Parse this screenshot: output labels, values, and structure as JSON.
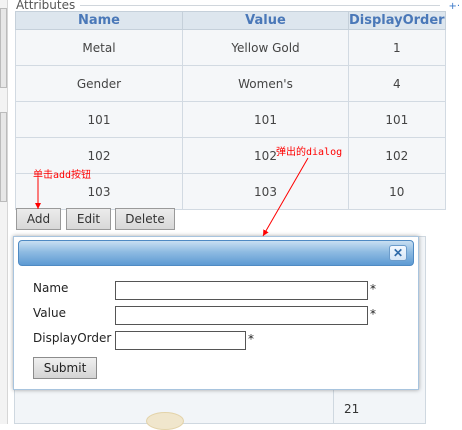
{
  "section": {
    "title": "Attributes"
  },
  "table": {
    "columns": [
      "Name",
      "Value",
      "DisplayOrder"
    ],
    "rows": [
      [
        "Metal",
        "Yellow Gold",
        "1"
      ],
      [
        "Gender",
        "Women's",
        "4"
      ],
      [
        "101",
        "101",
        "101"
      ],
      [
        "102",
        "102",
        "102"
      ],
      [
        "103",
        "103",
        "10"
      ]
    ]
  },
  "toolbar": {
    "add_label": "Add",
    "edit_label": "Edit",
    "delete_label": "Delete"
  },
  "annotations": {
    "click_add": "单击add按钮",
    "popup_dialog": "弹出的dialog"
  },
  "dialog": {
    "close_glyph": "✕",
    "fields": {
      "name_label": "Name",
      "value_label": "Value",
      "display_order_label": "DisplayOrder",
      "required_mark": "*",
      "name_value": "",
      "value_value": "",
      "display_order_value": ""
    },
    "submit_label": "Submit"
  },
  "background": {
    "partial_value": "21"
  },
  "icons": {
    "right_edge": "plus-dot-icon",
    "close": "close-icon"
  },
  "colors": {
    "header_text": "#4a78b8",
    "title_bar": "#5d9ad3",
    "annotation": "#ff0000"
  }
}
